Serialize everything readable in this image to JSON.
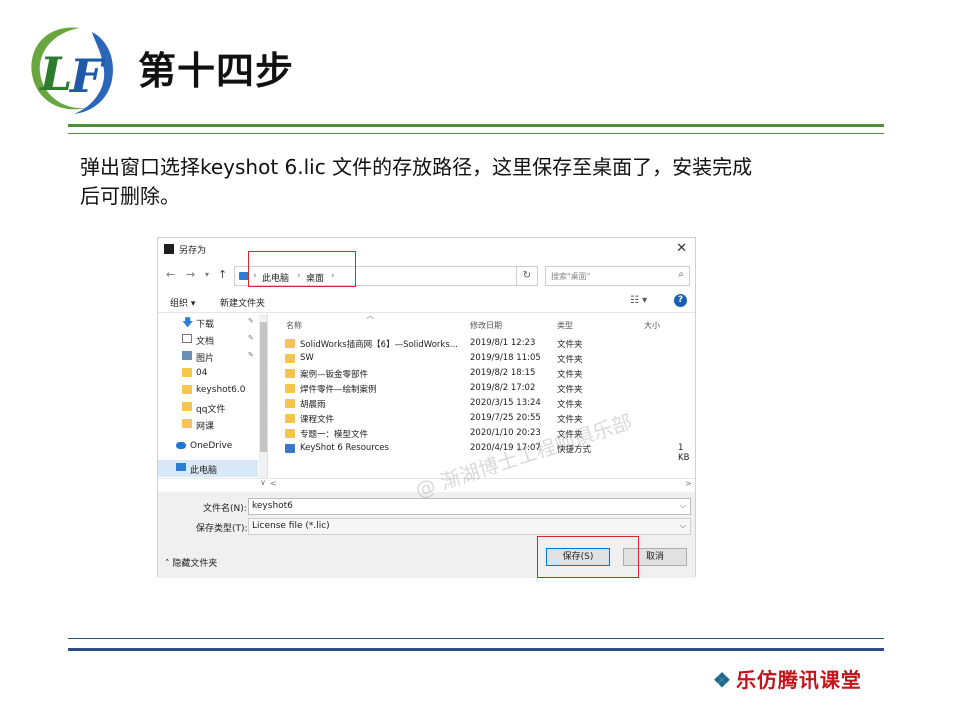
{
  "slide": {
    "logo_text": "LF",
    "title": "第十四步",
    "instruction_line1": "弹出窗口选择keyshot 6.lic 文件的存放路径，这里保存至桌面了，安装完成",
    "instruction_line2": "后可删除。",
    "brand": "乐仿腾讯课堂",
    "watermark": "@ 渐湖博士工程师俱乐部"
  },
  "dialog": {
    "title": "另存为",
    "breadcrumb": [
      "此电脑",
      "桌面"
    ],
    "search_placeholder": "搜索\"桌面\"",
    "toolbar": {
      "organize": "组织 ▾",
      "new_folder": "新建文件夹"
    },
    "sidebar": [
      {
        "label": "下载",
        "icon": "download-icon",
        "pinned": true
      },
      {
        "label": "文档",
        "icon": "document-icon",
        "pinned": true
      },
      {
        "label": "图片",
        "icon": "picture-icon",
        "pinned": true
      },
      {
        "label": "04",
        "icon": "folder-icon",
        "pinned": false
      },
      {
        "label": "keyshot6.0",
        "icon": "folder-icon",
        "pinned": false
      },
      {
        "label": "qq文件",
        "icon": "folder-icon",
        "pinned": false
      },
      {
        "label": "网课",
        "icon": "folder-icon",
        "pinned": false
      },
      {
        "label": "OneDrive",
        "icon": "onedrive-icon",
        "pinned": false
      },
      {
        "label": "此电脑",
        "icon": "computer-icon",
        "pinned": false,
        "selected": true
      }
    ],
    "columns": {
      "name": "名称",
      "date": "修改日期",
      "type": "类型",
      "size": "大小"
    },
    "files": [
      {
        "name": "SolidWorks插商网【6】—SolidWorks...",
        "date": "2019/8/1 12:23",
        "type": "文件夹",
        "size": ""
      },
      {
        "name": "SW",
        "date": "2019/9/18 11:05",
        "type": "文件夹",
        "size": ""
      },
      {
        "name": "案例—钣金零部件",
        "date": "2019/8/2 18:15",
        "type": "文件夹",
        "size": ""
      },
      {
        "name": "焊件零件—绘制案例",
        "date": "2019/8/2 17:02",
        "type": "文件夹",
        "size": ""
      },
      {
        "name": "胡晨雨",
        "date": "2020/3/15 13:24",
        "type": "文件夹",
        "size": ""
      },
      {
        "name": "课程文件",
        "date": "2019/7/25 20:55",
        "type": "文件夹",
        "size": ""
      },
      {
        "name": "专题一：模型文件",
        "date": "2020/1/10 20:23",
        "type": "文件夹",
        "size": ""
      },
      {
        "name": "KeyShot 6 Resources",
        "date": "2020/4/19 17:07",
        "type": "快捷方式",
        "size": "1 KB"
      }
    ],
    "filename_label": "文件名(N):",
    "filename_value": "keyshot6",
    "filetype_label": "保存类型(T):",
    "filetype_value": "License file (*.lic)",
    "hide_folders": "隐藏文件夹",
    "save_button": "保存(S)",
    "cancel_button": "取消"
  },
  "colors": {
    "accent_green": "#4f8f3a",
    "accent_blue": "#2e4f86",
    "highlight_red": "#d8262c",
    "brand_red": "#c2151b"
  }
}
